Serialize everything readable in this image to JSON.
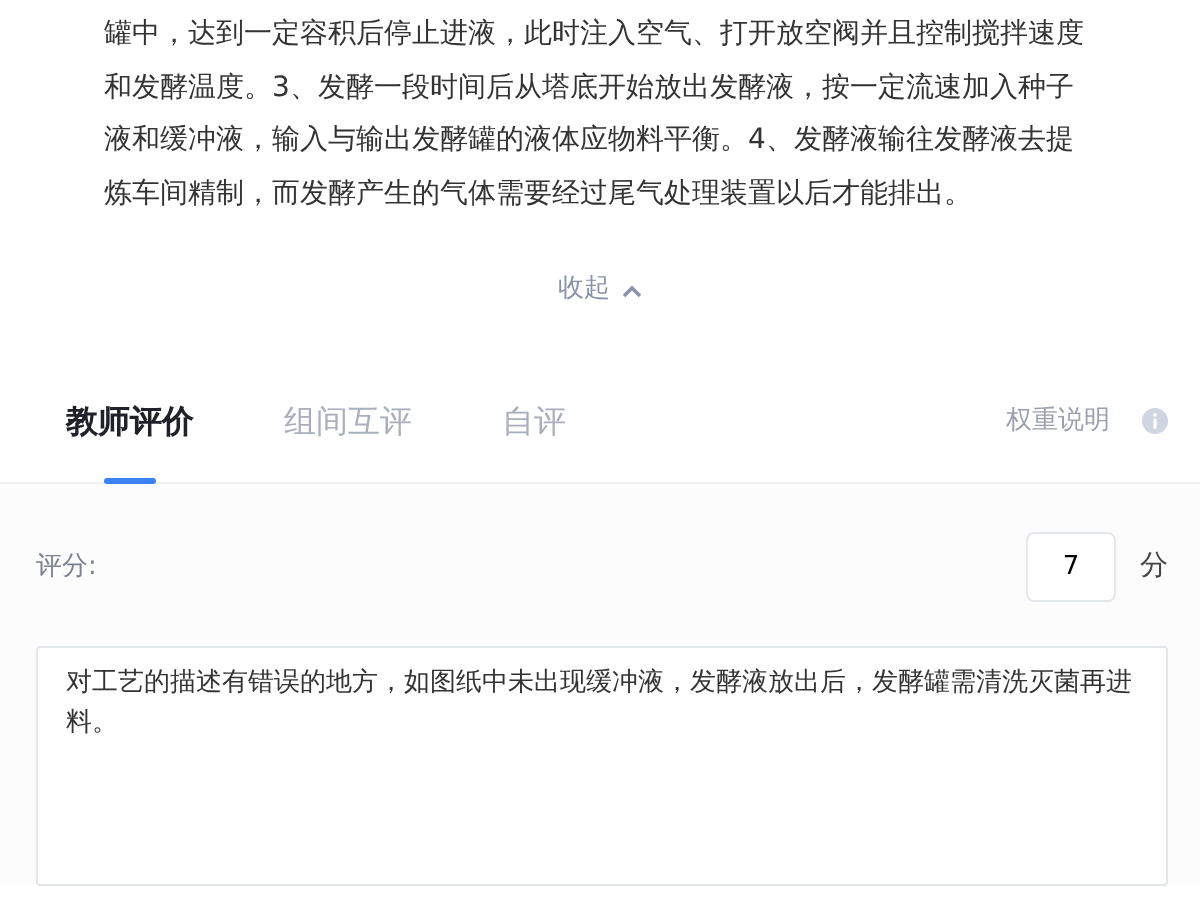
{
  "description": "罐中，达到一定容积后停止进液，此时注入空气、打开放空阀并且控制搅拌速度和发酵温度。3、发酵一段时间后从塔底开始放出发酵液，按一定流速加入种子液和缓冲液，输入与输出发酵罐的液体应物料平衡。4、发酵液输往发酵液去提炼车间精制，而发酵产生的气体需要经过尾气处理装置以后才能排出。",
  "collapse": {
    "label": "收起"
  },
  "tabs": [
    {
      "label": "教师评价",
      "selected": true
    },
    {
      "label": "组间互评",
      "selected": false
    },
    {
      "label": "自评",
      "selected": false
    }
  ],
  "weight_info": {
    "label": "权重说明"
  },
  "score": {
    "label": "评分:",
    "value": "7",
    "unit": "分"
  },
  "comment": {
    "value": "对工艺的描述有错误的地方，如图纸中未出现缓冲液，发酵液放出后，发酵罐需清洗灭菌再进料。"
  }
}
